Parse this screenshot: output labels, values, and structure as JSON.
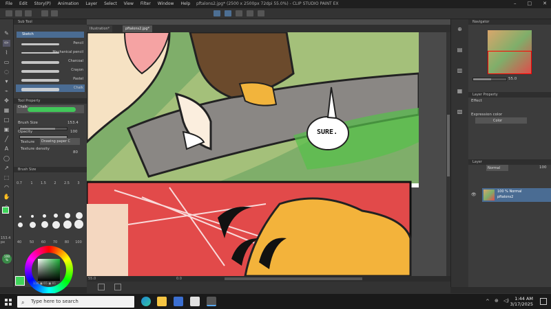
{
  "app": {
    "menu": [
      "File",
      "Edit",
      "Story(P)",
      "Animation",
      "Layer",
      "Select",
      "View",
      "Filter",
      "Window",
      "Help"
    ],
    "title": "pftalons2.jpg* (2500 x 2500px 72dpi 55.0%) - CLIP STUDIO PAINT EX",
    "window_buttons": [
      "–",
      "□",
      "✕"
    ]
  },
  "sub_tool": {
    "header": "Sub Tool",
    "group": "Sketch",
    "brushes": [
      "Pencil",
      "Mechanical pencil",
      "Charcoal",
      "Crayon",
      "Pastel",
      "Chalk"
    ]
  },
  "tool_property": {
    "header": "Tool Property",
    "brush_name": "Chalk",
    "brush_size_label": "Brush Size",
    "brush_size_value": "153.4",
    "opacity_label": "Opacity",
    "opacity_value": "100",
    "opacity_level": 1.0,
    "brush_size_level": 0.75,
    "texture_label": "Texture",
    "texture_value": "Drawing paper C",
    "texture_density_label": "Texture density",
    "texture_density_value": "80"
  },
  "brush_size_panel": {
    "header": "Brush Size",
    "sizes_row1": [
      "0.7",
      "1",
      "1.5",
      "2",
      "2.5",
      "3"
    ],
    "sizes_bottom": [
      "40",
      "50",
      "60",
      "70",
      "80",
      "100"
    ]
  },
  "left_status": {
    "size_readout": "153.4\npx",
    "opacity_readout": "100\n%",
    "color_readout": "116 ◼ 65 ◼ 81"
  },
  "colors": {
    "main_color": "#3fd45a",
    "sub_color": "#ffffff",
    "accent": "#4a90d9",
    "panel_bg": "#3c3c3c"
  },
  "tabs": [
    {
      "label": "Illustration*"
    },
    {
      "label": "pftalons2.jpg*"
    }
  ],
  "canvas": {
    "speech_bubble": "SURE.",
    "zoom": "55.0",
    "zoom_right": "55.0",
    "angle": "0.0"
  },
  "navigator": {
    "header": "Navigator"
  },
  "layer_property": {
    "header": "Layer Property",
    "effect_label": "Effect",
    "expression_color_label": "Expression color",
    "expression_color_value": "Color"
  },
  "layer_panel": {
    "header": "Layer",
    "blend_mode": "Normal",
    "opacity": "100",
    "layer_mode": "100 % Normal",
    "layer_name": "pftalons2"
  },
  "taskbar": {
    "search_placeholder": "Type here to search",
    "time": "1:44 AM",
    "date": "3/17/2025",
    "tray_icons": [
      "chevron-up-icon",
      "network-icon",
      "volume-icon"
    ]
  }
}
